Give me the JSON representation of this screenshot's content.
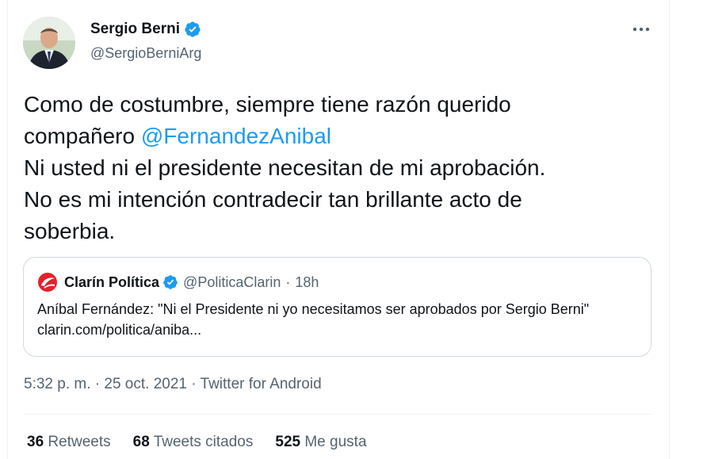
{
  "author": {
    "name": "Sergio Berni",
    "handle": "@SergioBerniArg"
  },
  "tweet": {
    "text_line1": "Como de costumbre, siempre tiene razón querido",
    "text_line2_prefix": "compañero ",
    "mention": "@FernandezAnibal",
    "text_line3": "Ni usted ni el presidente necesitan de mi aprobación.",
    "text_line4": "No es mi intención contradecir tan brillante acto de",
    "text_line5": "soberbia."
  },
  "quote": {
    "name": "Clarín Política",
    "handle": "@PoliticaClarin",
    "separator": "·",
    "time": "18h",
    "text": "Aníbal Fernández: \"Ni el Presidente ni yo necesitamos ser aprobados por Sergio Berni\" clarin.com/politica/aniba..."
  },
  "meta": {
    "time": "5:32 p. m.",
    "separator": "·",
    "date": "25 oct. 2021",
    "source": "Twitter for Android"
  },
  "stats": {
    "retweets_count": "36",
    "retweets_label": "Retweets",
    "quotes_count": "68",
    "quotes_label": "Tweets citados",
    "likes_count": "525",
    "likes_label": "Me gusta"
  },
  "colors": {
    "accent": "#1d9bf0",
    "secondary_text": "#536471",
    "border": "#cfd9de",
    "clarin_red": "#e3222b"
  },
  "icons": [
    "verified-badge-icon",
    "more-options-icon",
    "clarin-logo-icon"
  ]
}
